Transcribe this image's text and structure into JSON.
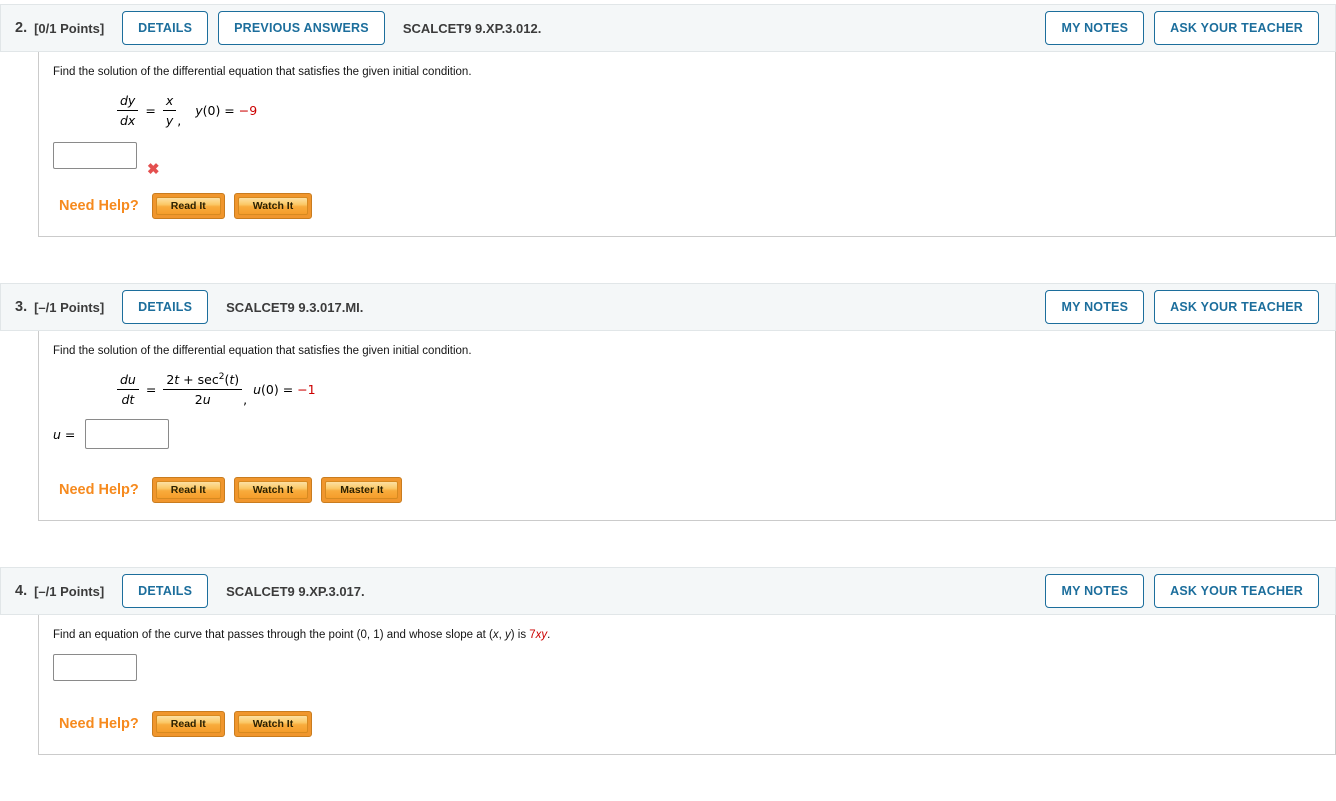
{
  "colors": {
    "accent_blue": "#1c6e9c",
    "header_bg": "#f4f7f8",
    "need_help_orange": "#f68a1e",
    "help_button_orange": "#f0962d",
    "error_red": "#e4504f",
    "math_value_red": "#cc0000"
  },
  "problems": [
    {
      "number": "2.",
      "points": "[0/1 Points]",
      "details_label": "DETAILS",
      "previous_answers_label": "PREVIOUS ANSWERS",
      "code": "SCALCET9 9.XP.3.012.",
      "my_notes_label": "MY NOTES",
      "ask_teacher_label": "ASK YOUR TEACHER",
      "prompt": "Find the solution of the differential equation that satisfies the given initial condition.",
      "equation": {
        "lhs_num": "dy",
        "lhs_den": "dx",
        "equals": "=",
        "rhs_num": "x",
        "rhs_den": "y",
        "comma": ",",
        "cond_var": "y",
        "cond_rest": "(0) = ",
        "cond_value": "−9"
      },
      "answer_value": "",
      "incorrect_icon": "✖",
      "need_help_label": "Need Help?",
      "help_buttons": [
        "Read It",
        "Watch It"
      ]
    },
    {
      "number": "3.",
      "points": "[–/1 Points]",
      "details_label": "DETAILS",
      "code": "SCALCET9 9.3.017.MI.",
      "my_notes_label": "MY NOTES",
      "ask_teacher_label": "ASK YOUR TEACHER",
      "prompt": "Find the solution of the differential equation that satisfies the given initial condition.",
      "equation": {
        "lhs_num": "du",
        "lhs_den": "dt",
        "equals": "=",
        "num_1": "2",
        "num_1v": "t",
        "num_2": " + sec",
        "num_sup": "2",
        "num_3": "(",
        "num_3v": "t",
        "num_4": ")",
        "den_1": "2",
        "den_1v": "u",
        "comma": ",",
        "cond_var": "u",
        "cond_rest": "(0) = ",
        "cond_value": "−1"
      },
      "answer_label_var": "u",
      "answer_label_eq": " = ",
      "answer_value": "",
      "need_help_label": "Need Help?",
      "help_buttons": [
        "Read It",
        "Watch It",
        "Master It"
      ]
    },
    {
      "number": "4.",
      "points": "[–/1 Points]",
      "details_label": "DETAILS",
      "code": "SCALCET9 9.XP.3.017.",
      "my_notes_label": "MY NOTES",
      "ask_teacher_label": "ASK YOUR TEACHER",
      "prompt_segments": {
        "s1": "Find an equation of the curve that passes through the point (0, 1) and whose slope at (",
        "var_x": "x",
        "s2": ", ",
        "var_y": "y",
        "s3": ") is ",
        "value_coeff": "7",
        "value_vars": "xy",
        "s4": "."
      },
      "answer_value": "",
      "need_help_label": "Need Help?",
      "help_buttons": [
        "Read It",
        "Watch It"
      ]
    }
  ]
}
